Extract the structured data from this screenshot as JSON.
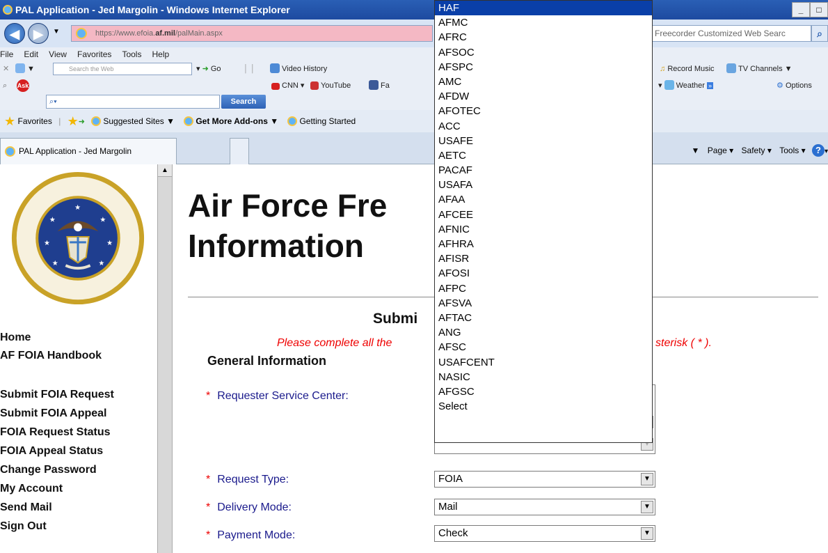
{
  "window": {
    "title": "PAL Application - Jed Margolin - Windows Internet Explorer",
    "controls": [
      "_",
      "□"
    ]
  },
  "address_bar": {
    "url_prefix": "https://www.efoia.",
    "url_domain": "af.mil",
    "url_path": "/palMain.aspx",
    "search_placeholder": "Freecorder Customized Web Searc"
  },
  "menu": [
    "File",
    "Edit",
    "View",
    "Favorites",
    "Tools",
    "Help"
  ],
  "toolbar1": {
    "search_web_placeholder": "Search the Web",
    "go_label": "Go",
    "video_history": "Video History",
    "record_music": "Record Music",
    "tv_channels": "TV Channels"
  },
  "toolbar2": {
    "search_button": "Search",
    "cnn": "CNN",
    "youtube": "YouTube",
    "facebook_partial": "Fa",
    "weather": "Weather",
    "options": "Options"
  },
  "favorites_bar": {
    "favorites": "Favorites",
    "suggested_sites": "Suggested Sites",
    "get_more_addons": "Get More Add-ons",
    "getting_started": "Getting Started"
  },
  "tab": {
    "label": "PAL Application - Jed Margolin"
  },
  "command_bar": {
    "page": "Page",
    "safety": "Safety",
    "tools": "Tools"
  },
  "sidebar": {
    "links": [
      {
        "label": "Home"
      },
      {
        "label": "AF FOIA Handbook"
      },
      {
        "label": "Submit FOIA Request"
      },
      {
        "label": "Submit FOIA Appeal"
      },
      {
        "label": "FOIA Request Status"
      },
      {
        "label": "FOIA Appeal Status"
      },
      {
        "label": "Change Password"
      },
      {
        "label": "My Account"
      },
      {
        "label": "Send Mail"
      },
      {
        "label": "Sign Out"
      }
    ]
  },
  "main": {
    "title_line1": "Air Force Fre",
    "title_line2": "Information",
    "subtitle": "Submi",
    "instruction_left": "Please complete all the",
    "instruction_right": "sterisk ( * ).",
    "section": "General Information",
    "fields": [
      {
        "label": "Requester Service Center:",
        "value": ""
      },
      {
        "label": "Request Type:",
        "value": "FOIA"
      },
      {
        "label": "Delivery Mode:",
        "value": "Mail"
      },
      {
        "label": "Payment Mode:",
        "value": "Check"
      }
    ]
  },
  "dropdown_options": [
    "HAF",
    "AFMC",
    "AFRC",
    "AFSOC",
    "AFSPC",
    "AMC",
    "AFDW",
    "AFOTEC",
    "ACC",
    "USAFE",
    "AETC",
    "PACAF",
    "USAFA",
    "AFAA",
    "AFCEE",
    "AFNIC",
    "AFHRA",
    "AFISR",
    "AFOSI",
    "AFPC",
    "AFSVA",
    "AFTAC",
    "ANG",
    "AFSC",
    "USAFCENT",
    "NASIC",
    "AFGSC",
    "Select"
  ],
  "dropdown_selected": "HAF",
  "colors": {
    "titlebar": "#1d4aa0",
    "required_asterisk": "#e00000",
    "label_blue": "#1a1a8c",
    "dropdown_highlight": "#0a3fa8",
    "url_bar_bg": "#f4b8c4"
  }
}
